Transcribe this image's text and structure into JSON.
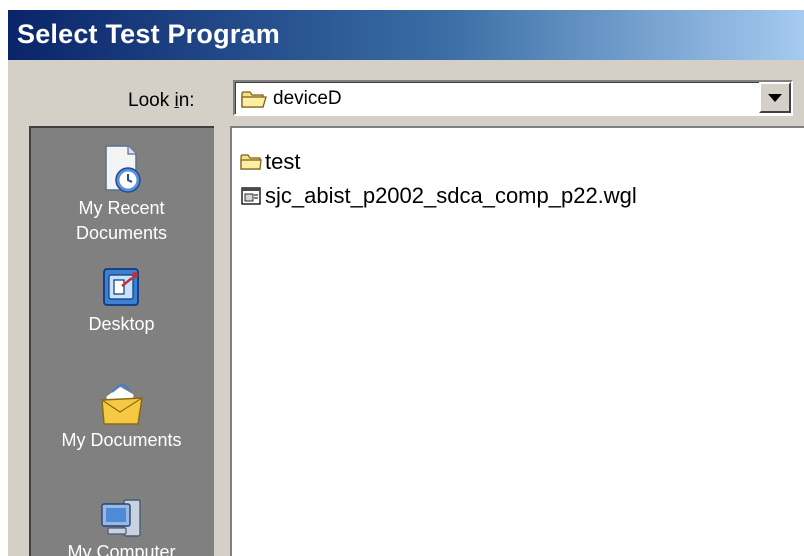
{
  "dialog": {
    "title": "Select Test Program"
  },
  "lookin": {
    "label_prefix": "Look ",
    "label_accel": "i",
    "label_suffix": "n:",
    "value": "deviceD",
    "value_icon": "folder-icon",
    "dropdown_icon": "chevron-down-icon"
  },
  "places_bar": {
    "items": [
      {
        "line1": "My Recent",
        "line2": "Documents",
        "icon": "recent-documents-icon"
      },
      {
        "line1": "Desktop",
        "line2": "",
        "icon": "desktop-icon"
      },
      {
        "line1": "My Documents",
        "line2": "",
        "icon": "my-documents-icon"
      },
      {
        "line1": "My Computer",
        "line2": "",
        "icon": "my-computer-icon"
      }
    ]
  },
  "files": [
    {
      "name": "test",
      "icon": "folder-icon"
    },
    {
      "name": "sjc_abist_p2002_sdca_comp_p22.wgl",
      "icon": "file-icon"
    }
  ],
  "colors": {
    "titlebar_start": "#0a246a",
    "titlebar_end": "#a6caf0",
    "dialog_bg": "#d4d0c8",
    "places_bg": "#808080"
  }
}
